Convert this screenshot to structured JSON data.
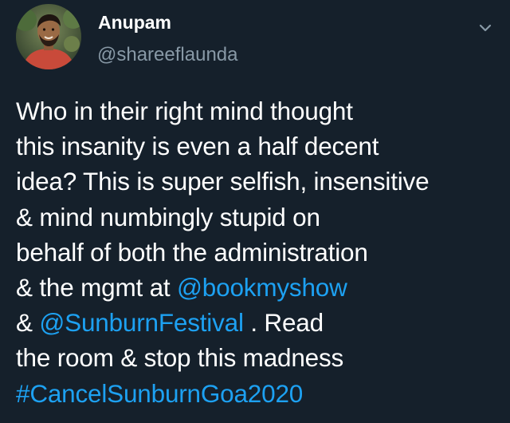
{
  "tweet": {
    "author": {
      "display_name": "Anupam",
      "handle": "@shareeflaunda",
      "avatar_icon": "profile-photo"
    },
    "menu_icon": "chevron-down-icon",
    "body": {
      "line1": "Who in their right mind thought",
      "line2": "this insanity is even a half decent",
      "line3": "idea? This is super selfish, insensitive",
      "line4": "& mind numbingly stupid on",
      "line5": "behalf of both the administration",
      "line6_prefix": "& the mgmt at ",
      "mention_bookmyshow": "@bookmyshow",
      "line7_prefix": "& ",
      "mention_sunburn": "@SunburnFestival",
      "line7_suffix": " . Read",
      "line8": "the room & stop this madness",
      "hashtag": "#CancelSunburnGoa2020"
    }
  },
  "colors": {
    "background": "#15202b",
    "text": "#ffffff",
    "secondary_text": "#8899a6",
    "link": "#1da1f2"
  }
}
